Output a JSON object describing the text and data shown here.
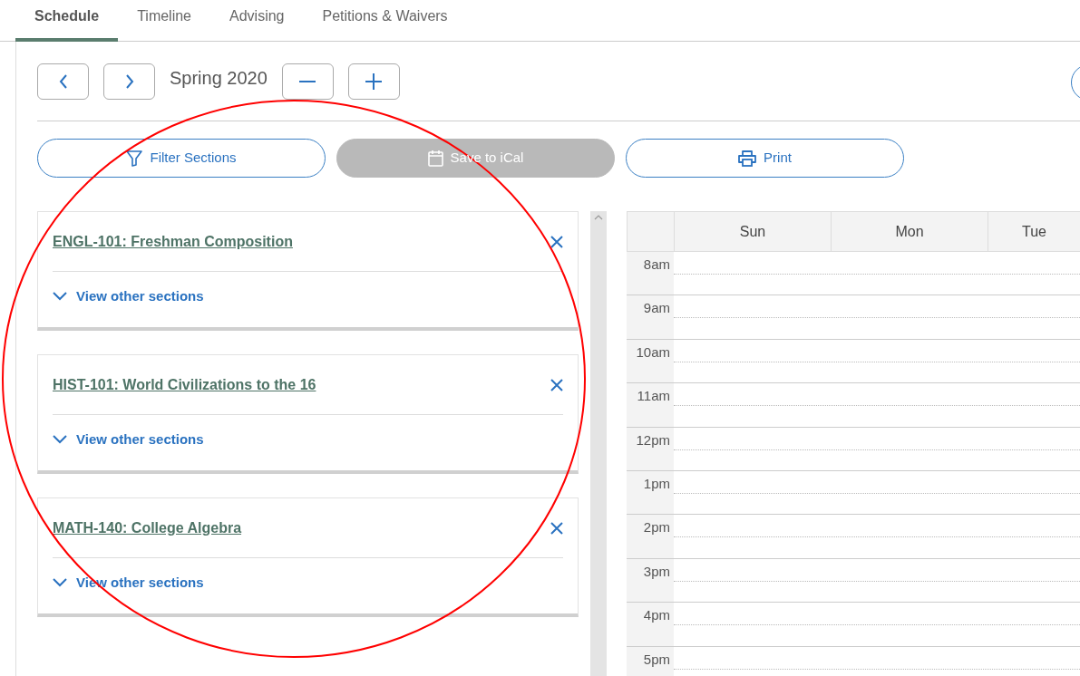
{
  "tabs": [
    {
      "label": "Schedule",
      "selected": true
    },
    {
      "label": "Timeline",
      "selected": false
    },
    {
      "label": "Advising",
      "selected": false
    },
    {
      "label": "Petitions & Waivers",
      "selected": false
    }
  ],
  "term": {
    "label": "Spring 2020"
  },
  "actions": [
    {
      "label": "Filter Sections",
      "kind": "filter",
      "disabled": false
    },
    {
      "label": "Save to iCal",
      "kind": "calendar",
      "disabled": true
    },
    {
      "label": "Print",
      "kind": "printer",
      "disabled": false
    }
  ],
  "courses": [
    {
      "title": "ENGL-101: Freshman Composition",
      "toggle": "View other sections",
      "expanded": false
    },
    {
      "title": "HIST-101: World Civilizations to the 16",
      "toggle": "View other sections",
      "expanded": false
    },
    {
      "title": "MATH-140: College Algebra",
      "toggle": "View other sections",
      "expanded": false
    }
  ],
  "calendar": {
    "days": [
      "Sun",
      "Mon",
      "Tue"
    ],
    "hours": [
      "8am",
      "9am",
      "10am",
      "11am",
      "12pm",
      "1pm",
      "2pm",
      "3pm",
      "4pm",
      "5pm"
    ]
  },
  "annotation": {
    "kind": "ellipse"
  }
}
